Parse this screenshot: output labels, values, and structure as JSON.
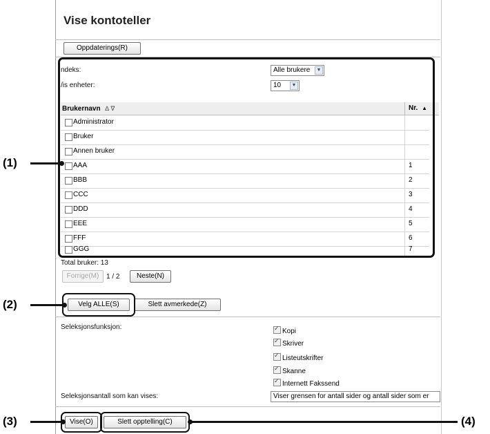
{
  "page": {
    "title": "Vise kontoteller",
    "update_button": "Oppdaterings(R)"
  },
  "filter": {
    "index_label": "ndeks:",
    "index_value": "Alle brukere",
    "show_units_label": "/is enheter:",
    "show_units_value": "10"
  },
  "table": {
    "col_user": "Brukernavn",
    "col_user_sort": "∆ ∇",
    "col_nr": "Nr.",
    "col_nr_sort": "▲",
    "rows": [
      {
        "name": "Administrator",
        "nr": ""
      },
      {
        "name": "Bruker",
        "nr": ""
      },
      {
        "name": "Annen bruker",
        "nr": ""
      },
      {
        "name": "AAA",
        "nr": "1"
      },
      {
        "name": "BBB",
        "nr": "2"
      },
      {
        "name": "CCC",
        "nr": "3"
      },
      {
        "name": "DDD",
        "nr": "4"
      },
      {
        "name": "EEE",
        "nr": "5"
      },
      {
        "name": "FFF",
        "nr": "6"
      },
      {
        "name": "GGG",
        "nr": "7"
      }
    ]
  },
  "pagination": {
    "total_label": "Total bruker: 13",
    "prev_button": "Forrige(M)",
    "page_indicator": "1 / 2",
    "next_button": "Neste(N)"
  },
  "selection_buttons": {
    "select_all": "Velg ALLE(S)",
    "clear_marked": "Slett avmerkede(Z)"
  },
  "function": {
    "label": "Seleksjonsfunksjon:",
    "options": [
      "Kopi",
      "Skriver",
      "Listeutskrifter",
      "Skanne",
      "Internett Fakssend"
    ]
  },
  "count": {
    "label": "Seleksjonsantall som kan vises:",
    "value": "Viser grensen for antall sider og antall sider som er"
  },
  "bottom_buttons": {
    "view": "Vise(O)",
    "clear_count": "Slett opptelling(C)"
  },
  "callouts": {
    "c1": "(1)",
    "c2": "(2)",
    "c3": "(3)",
    "c4": "(4)"
  }
}
